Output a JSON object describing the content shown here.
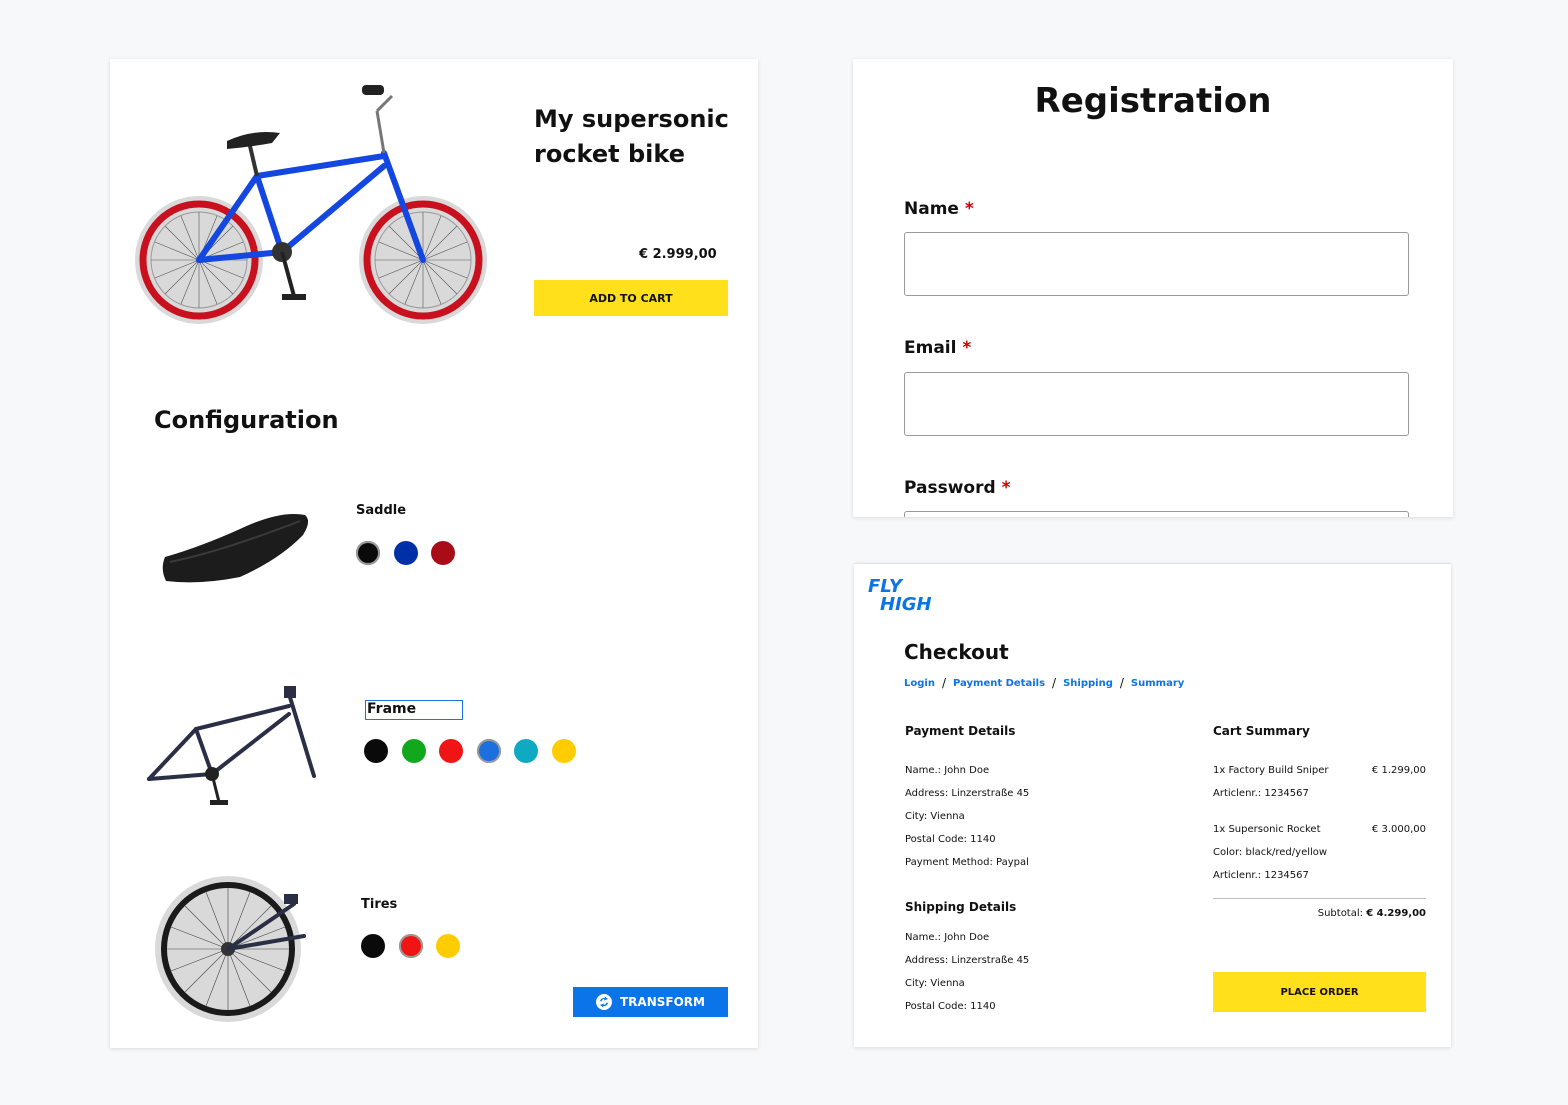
{
  "product": {
    "title": "My supersonic rocket bike",
    "price": "€ 2.999,00",
    "add_to_cart": "ADD TO CART",
    "configuration_title": "Configuration",
    "parts": [
      {
        "label": "Saddle",
        "swatches": [
          "#0a0a0a",
          "#0030a8",
          "#a80d17"
        ],
        "selected": 0
      },
      {
        "label": "Frame",
        "swatches": [
          "#0a0a0a",
          "#12a81e",
          "#f01414",
          "#1b6fde",
          "#0fa9c2",
          "#ffcc00"
        ],
        "selected": 3
      },
      {
        "label": "Tires",
        "swatches": [
          "#0a0a0a",
          "#f01414",
          "#ffcc00"
        ],
        "selected": 1
      }
    ],
    "transform": "TRANSFORM"
  },
  "registration": {
    "title": "Registration",
    "fields": [
      {
        "label": "Name",
        "required": "*"
      },
      {
        "label": "Email",
        "required": "*"
      },
      {
        "label": "Password",
        "required": "*"
      }
    ]
  },
  "checkout": {
    "logo_line1": "FLY",
    "logo_line2": "HIGH",
    "title": "Checkout",
    "breadcrumb": [
      "Login",
      "Payment Details",
      "Shipping",
      "Summary"
    ],
    "payment_details": {
      "heading": "Payment Details",
      "lines": [
        "Name.: John Doe",
        "Address: Linzerstraße 45",
        "City: Vienna",
        "Postal Code: 1140",
        "Payment Method: Paypal"
      ]
    },
    "shipping_details": {
      "heading": "Shipping Details",
      "lines": [
        "Name.: John Doe",
        "Address: Linzerstraße 45",
        "City: Vienna",
        "Postal Code: 1140"
      ]
    },
    "cart_summary": {
      "heading": "Cart Summary",
      "items": [
        {
          "name": "1x Factory Build Sniper",
          "price": "€ 1.299,00",
          "details": [
            "Articlenr.: 1234567"
          ]
        },
        {
          "name": "1x Supersonic Rocket",
          "price": "€ 3.000,00",
          "details": [
            "Color: black/red/yellow",
            "Articlenr.: 1234567"
          ]
        }
      ],
      "subtotal_label": "Subtotal:",
      "subtotal_value": "€ 4.299,00"
    },
    "place_order": "PLACE ORDER"
  }
}
